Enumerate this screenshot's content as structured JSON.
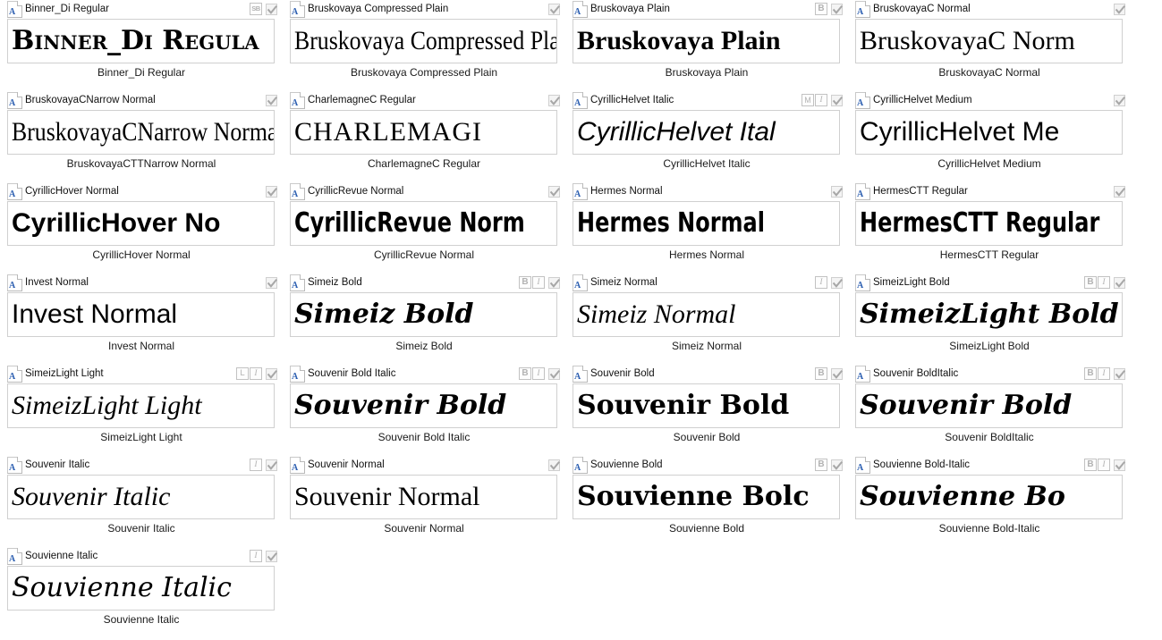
{
  "window": {
    "icon_letter": "A",
    "checkmark": "✔"
  },
  "fonts": [
    {
      "title": "Binner_Di Regular",
      "preview": "Binner_Di Regula",
      "caption": "Binner_Di Regular",
      "badges": [
        "SB"
      ],
      "checked": true,
      "style": "pv-display"
    },
    {
      "title": "Bruskovaya Compressed Plain",
      "preview": "Bruskovaya Compressed Pla",
      "caption": "Bruskovaya Compressed Plain",
      "badges": [],
      "checked": true,
      "style": "pv-serif-narrow"
    },
    {
      "title": "Bruskovaya Plain",
      "preview": "Bruskovaya Plain",
      "caption": "Bruskovaya Plain",
      "badges": [
        "B"
      ],
      "checked": true,
      "style": "pv-serif-b"
    },
    {
      "title": "BruskovayaC Normal",
      "preview": "BruskovayaC Norm",
      "caption": "BruskovayaC Normal",
      "badges": [],
      "checked": true,
      "style": "pv-serif"
    },
    {
      "title": "BruskovayaCNarrow Normal",
      "preview": "BruskovayaCNarrow Norma",
      "caption": "BruskovayaCTTNarrow Normal",
      "badges": [],
      "checked": true,
      "style": "pv-serif-narrow"
    },
    {
      "title": "CharlemagneC Regular",
      "preview": "CHARLEMAGI",
      "caption": "CharlemagneC Regular",
      "badges": [],
      "checked": true,
      "style": "pv-caps"
    },
    {
      "title": "CyrillicHelvet Italic",
      "preview": "CyrillicHelvet Ital",
      "caption": "CyrillicHelvet Italic",
      "badges": [
        "M",
        "I"
      ],
      "checked": true,
      "style": "pv-sans-i"
    },
    {
      "title": "CyrillicHelvet Medium",
      "preview": "CyrillicHelvet Me",
      "caption": "CyrillicHelvet Medium",
      "badges": [],
      "checked": true,
      "style": "pv-sans"
    },
    {
      "title": "CyrillicHover Normal",
      "preview": "CyrillicHover No",
      "caption": "CyrillicHover Normal",
      "badges": [],
      "checked": true,
      "style": "pv-sans-b"
    },
    {
      "title": "CyrillicRevue Normal",
      "preview": "CyrillicRevue Norm",
      "caption": "CyrillicRevue Normal",
      "badges": [],
      "checked": true,
      "style": "pv-cond-b"
    },
    {
      "title": "Hermes Normal",
      "preview": "Hermes Normal",
      "caption": "Hermes Normal",
      "badges": [],
      "checked": true,
      "style": "pv-cond-b"
    },
    {
      "title": "HermesCTT Regular",
      "preview": "HermesCTT Regular",
      "caption": "HermesCTT Regular",
      "badges": [],
      "checked": true,
      "style": "pv-cond-b"
    },
    {
      "title": "Invest Normal",
      "preview": "Invest  Normal",
      "caption": "Invest Normal",
      "badges": [],
      "checked": true,
      "style": "pv-sans"
    },
    {
      "title": "Simeiz Bold",
      "preview": "Simeiz Bold",
      "caption": "Simeiz Bold",
      "badges": [
        "B",
        "I"
      ],
      "checked": true,
      "style": "pv-dejavu-serif-bi"
    },
    {
      "title": "Simeiz Normal",
      "preview": "Simeiz Normal",
      "caption": "Simeiz Normal",
      "badges": [
        "I"
      ],
      "checked": true,
      "style": "pv-serif-i"
    },
    {
      "title": "SimeizLight Bold",
      "preview": "SimeizLight Bold",
      "caption": "SimeizLight Bold",
      "badges": [
        "B",
        "I"
      ],
      "checked": true,
      "style": "pv-dejavu-serif-bi"
    },
    {
      "title": "SimeizLight Light",
      "preview": "SimeizLight Light",
      "caption": "SimeizLight Light",
      "badges": [
        "L",
        "I"
      ],
      "checked": true,
      "style": "pv-serif-i"
    },
    {
      "title": "Souvenir Bold Italic",
      "preview": "Souvenir Bold",
      "caption": "Souvenir Bold Italic",
      "badges": [
        "B",
        "I"
      ],
      "checked": true,
      "style": "pv-dejavu-serif-bi"
    },
    {
      "title": "Souvenir Bold",
      "preview": "Souvenir Bold",
      "caption": "Souvenir Bold",
      "badges": [
        "B"
      ],
      "checked": true,
      "style": "pv-dejavu-serif-b"
    },
    {
      "title": "Souvenir BoldItalic",
      "preview": "Souvenir Bold",
      "caption": "Souvenir BoldItalic",
      "badges": [
        "B",
        "I"
      ],
      "checked": true,
      "style": "pv-dejavu-serif-bi"
    },
    {
      "title": "Souvenir Italic",
      "preview": "Souvenir Italic",
      "caption": "Souvenir Italic",
      "badges": [
        "I"
      ],
      "checked": true,
      "style": "pv-serif-i"
    },
    {
      "title": "Souvenir Normal",
      "preview": "Souvenir Normal",
      "caption": "Souvenir Normal",
      "badges": [],
      "checked": true,
      "style": "pv-serif"
    },
    {
      "title": "Souvienne Bold",
      "preview": "Souvienne Bolc",
      "caption": "Souvienne Bold",
      "badges": [
        "B"
      ],
      "checked": true,
      "style": "pv-dejavu-serif-b"
    },
    {
      "title": "Souvienne Bold-Italic",
      "preview": "Souvienne Bo",
      "caption": "Souvienne Bold-Italic",
      "badges": [
        "B",
        "I"
      ],
      "checked": true,
      "style": "pv-dejavu-serif-bi"
    },
    {
      "title": "Souvienne Italic",
      "preview": "Souvienne Italic",
      "caption": "Souvienne Italic",
      "badges": [
        "I"
      ],
      "checked": true,
      "style": "pv-dejavu-serif-i"
    }
  ]
}
